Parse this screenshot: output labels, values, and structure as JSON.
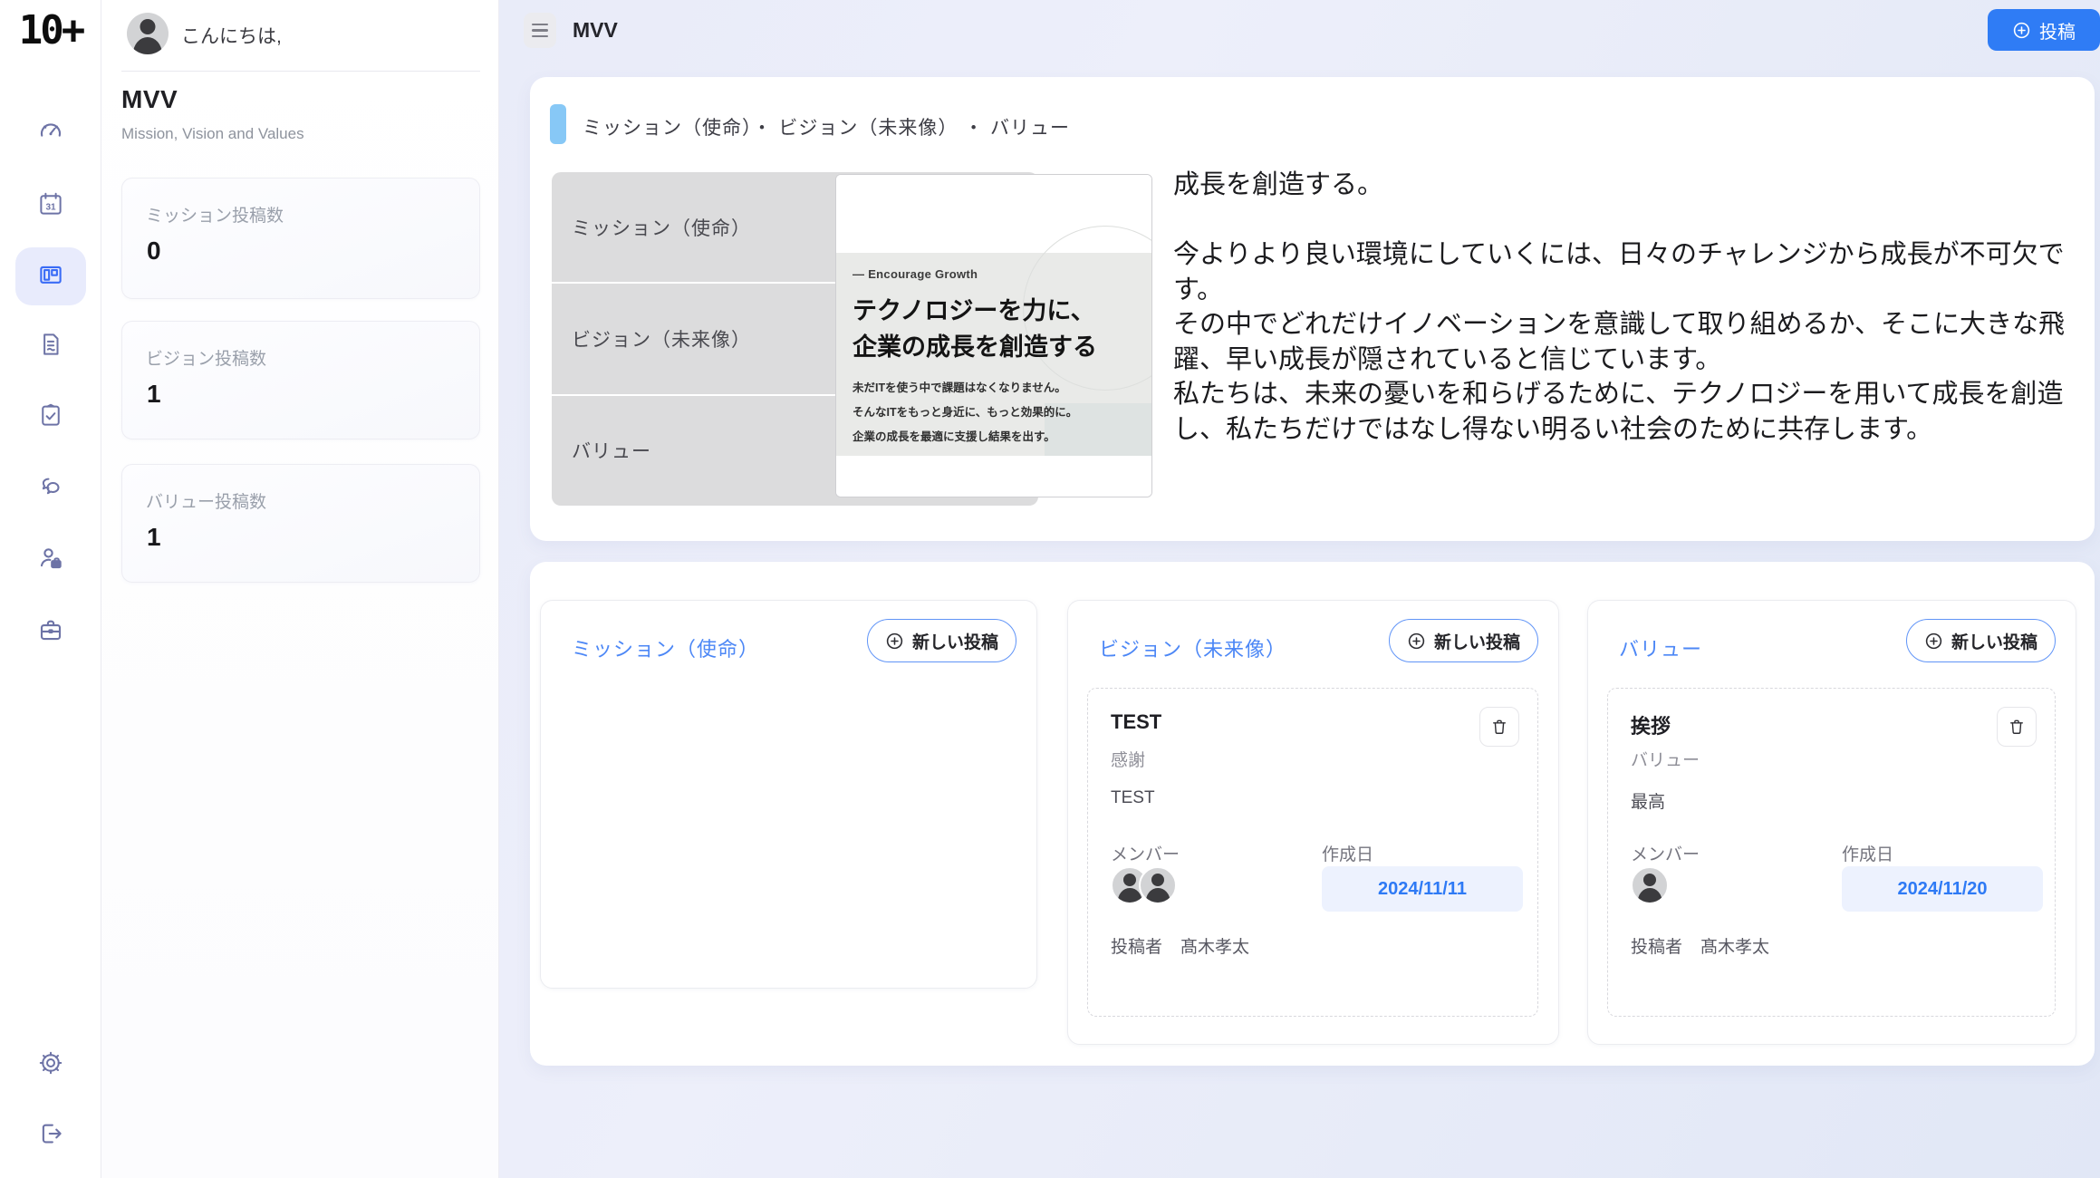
{
  "app": {
    "logo": "10+",
    "accent_blue": "#2f7cf5",
    "marker_blue": "#87c8f6"
  },
  "rail": {
    "icons": [
      "dashboard",
      "calendar",
      "mvv-board",
      "documents",
      "tasks",
      "chat",
      "members",
      "work",
      "settings",
      "logout"
    ],
    "active": "mvv-board"
  },
  "side_panel": {
    "greeting": "こんにちは,",
    "title": "MVV",
    "subtitle": "Mission, Vision and Values",
    "stats": [
      {
        "label": "ミッション投稿数",
        "value": "0"
      },
      {
        "label": "ビジョン投稿数",
        "value": "1"
      },
      {
        "label": "バリュー投稿数",
        "value": "1"
      }
    ]
  },
  "header": {
    "title": "MVV",
    "post_button": "投稿"
  },
  "overview": {
    "section_title": "ミッション（使命）・ ビジョン（未来像） ・ バリュー",
    "tabs": [
      "ミッション（使命）",
      "ビジョン（未来像）",
      "バリュー"
    ],
    "poster": {
      "eyebrow": "— Encourage Growth",
      "headline_line1": "テクノロジーを力に、",
      "headline_line2": "企業の成長を創造する",
      "lines": [
        "未だITを使う中で課題はなくなりません。",
        "そんなITをもっと身近に、もっと効果的に。",
        "企業の成長を最適に支援し結果を出す。"
      ]
    },
    "body": "成長を創造する。\n\n今よりより良い環境にしていくには、日々のチャレンジから成長が不可欠です。\nその中でどれだけイノベーションを意識して取り組めるか、そこに大きな飛躍、早い成長が隠されていると信じています。\n私たちは、未来の憂いを和らげるために、テクノロジーを用いて成長を創造し、私たちだけではなし得ない明るい社会のために共存します。"
  },
  "columns": [
    {
      "title": "ミッション（使命）",
      "new_post_label": "新しい投稿"
    },
    {
      "title": "ビジョン（未来像）",
      "new_post_label": "新しい投稿",
      "entry": {
        "title": "TEST",
        "category": "感謝",
        "body": "TEST",
        "members_label": "メンバー",
        "created_label": "作成日",
        "date": "2024/11/11",
        "author_label": "投稿者",
        "author": "髙木孝太"
      }
    },
    {
      "title": "バリュー",
      "new_post_label": "新しい投稿",
      "entry": {
        "title": "挨拶",
        "category": "バリュー",
        "body": "最高",
        "members_label": "メンバー",
        "created_label": "作成日",
        "date": "2024/11/20",
        "author_label": "投稿者",
        "author": "髙木孝太"
      }
    }
  ]
}
